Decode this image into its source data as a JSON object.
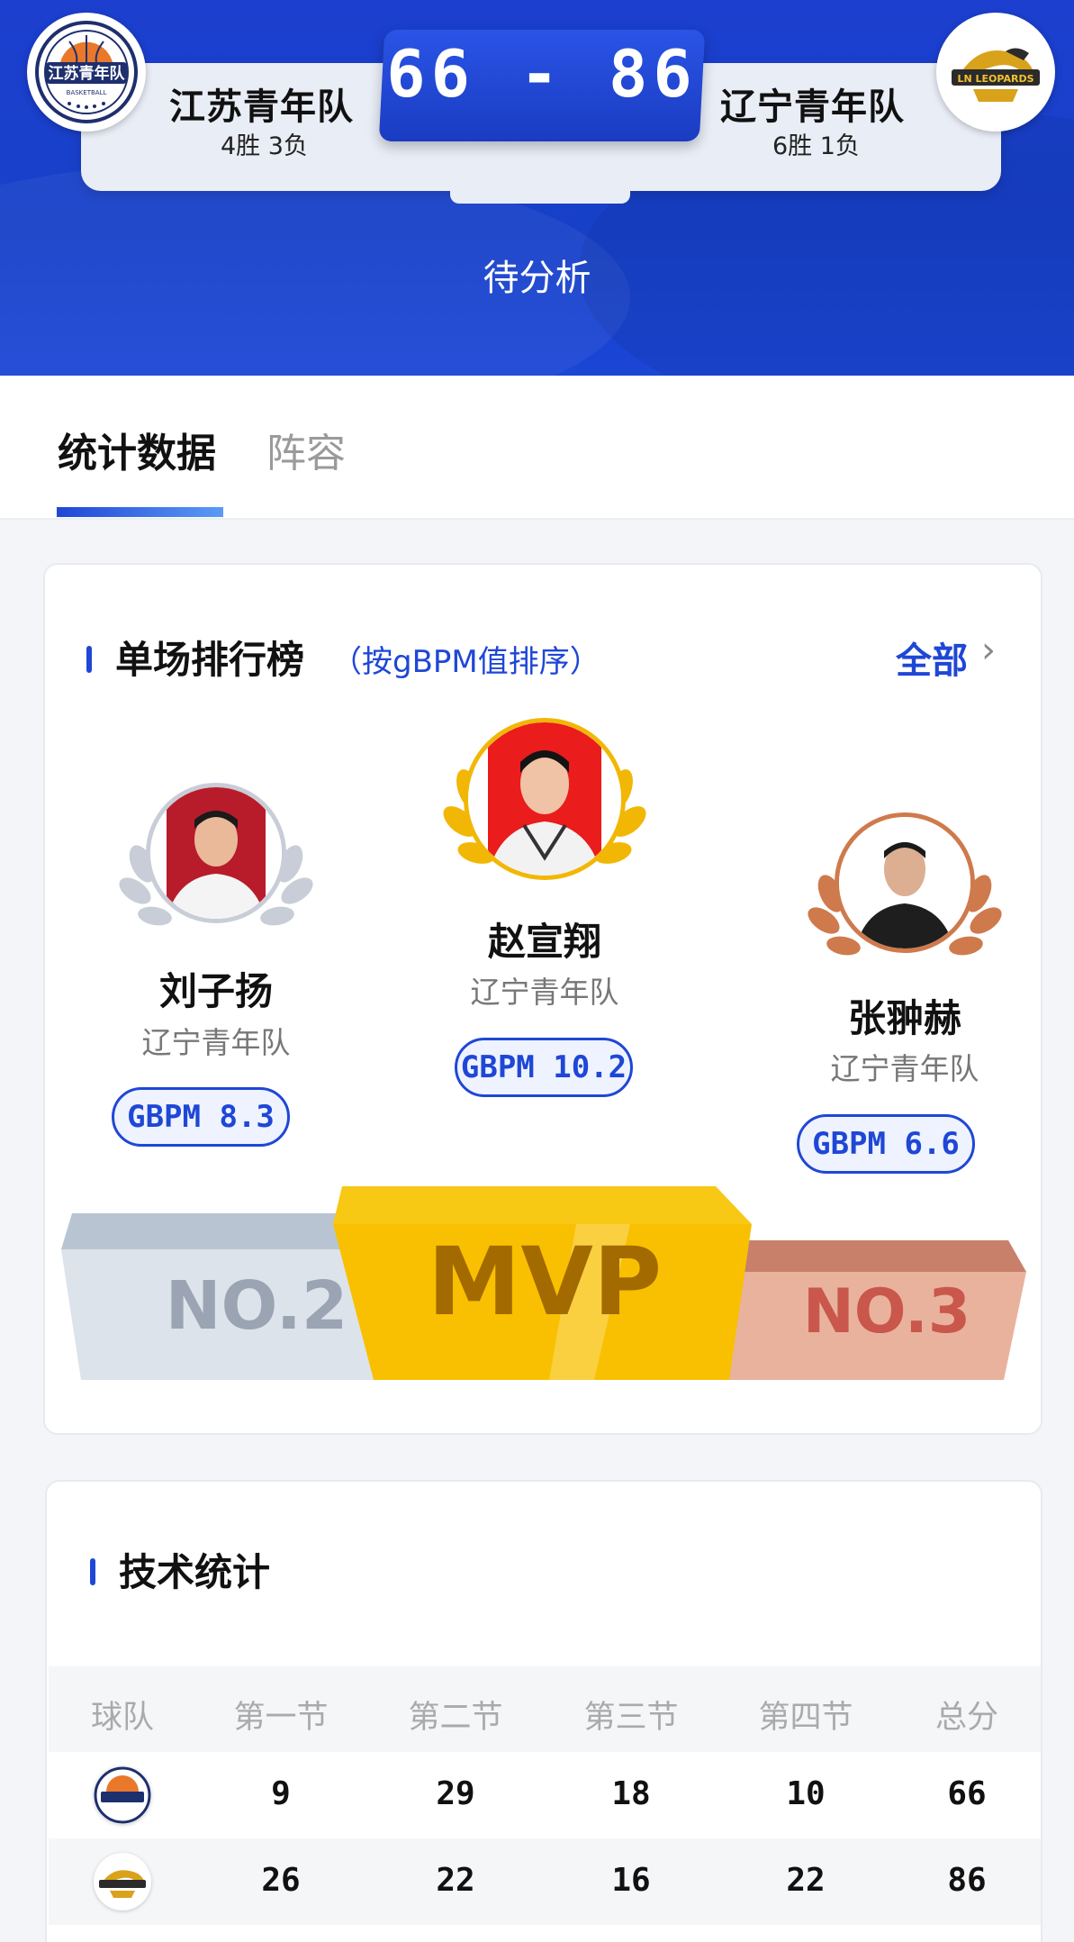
{
  "match": {
    "home": {
      "name": "江苏青年队",
      "record": "4胜 3负",
      "logo_icon": "jiangsu-youth-basketball-logo"
    },
    "away": {
      "name": "辽宁青年队",
      "record": "6胜 1负",
      "logo_icon": "liaoning-leopards-logo"
    },
    "score": "66 - 86",
    "status": "待分析"
  },
  "tabs": [
    {
      "label": "统计数据",
      "active": true
    },
    {
      "label": "阵容",
      "active": false
    }
  ],
  "ranking": {
    "title": "单场排行榜",
    "subtitle": "（按gBPM值排序）",
    "more_label": "全部",
    "players": [
      {
        "rank": "NO.2",
        "name": "刘子扬",
        "team": "辽宁青年队",
        "gbpm": "GBPM 8.3",
        "laurel_color": "#c8cdd8",
        "photo_bg": "#b81c2a"
      },
      {
        "rank": "MVP",
        "name": "赵宣翔",
        "team": "辽宁青年队",
        "gbpm": "GBPM 10.2",
        "laurel_color": "#f2b705",
        "photo_bg": "#ea1c1c"
      },
      {
        "rank": "NO.3",
        "name": "张翀赫",
        "team": "辽宁青年队",
        "gbpm": "GBPM 6.6",
        "laurel_color": "#cf7a4c",
        "photo_bg": "#ffffff"
      }
    ],
    "podium": {
      "second": "NO.2",
      "first": "MVP",
      "third": "NO.3"
    }
  },
  "stats": {
    "title": "技术统计",
    "headers": [
      "球队",
      "第一节",
      "第二节",
      "第三节",
      "第四节",
      "总分"
    ],
    "rows": [
      {
        "team_icon": "jiangsu-youth-basketball-logo",
        "q1": "9",
        "q2": "29",
        "q3": "18",
        "q4": "10",
        "total": "66"
      },
      {
        "team_icon": "liaoning-leopards-logo",
        "q1": "26",
        "q2": "22",
        "q3": "16",
        "q4": "22",
        "total": "86"
      }
    ]
  },
  "colors": {
    "primary": "#1f47d6",
    "gold": "#f2b705",
    "silver": "#c8cdd8",
    "bronze": "#cf7a4c"
  }
}
